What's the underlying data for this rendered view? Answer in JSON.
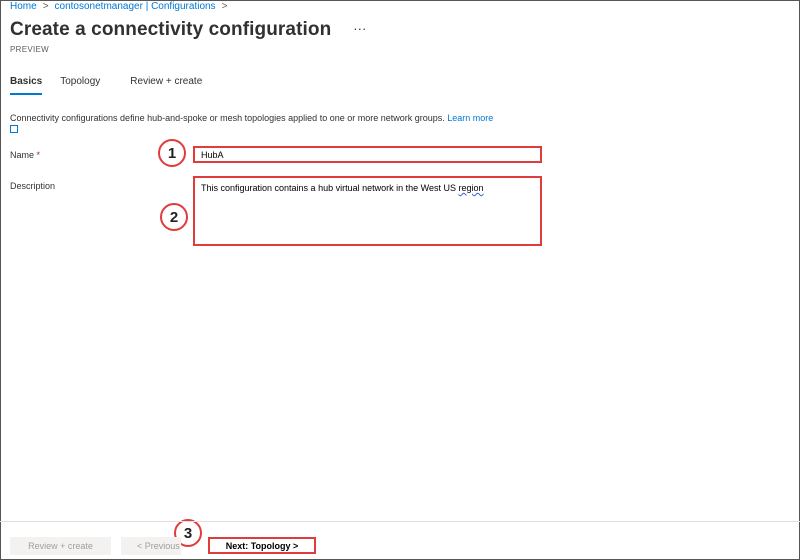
{
  "breadcrumb": {
    "items": [
      "Home",
      "contosonetmanager | Configurations"
    ],
    "separator": ">"
  },
  "header": {
    "title": "Create a connectivity configuration",
    "more": "···",
    "subtitle": "PREVIEW"
  },
  "tabs": [
    {
      "label": "Basics",
      "active": true
    },
    {
      "label": "Topology",
      "active": false
    },
    {
      "label": "Review + create",
      "active": false
    }
  ],
  "intro": {
    "text": "Connectivity configurations define hub-and-spoke or mesh topologies applied to one or more network groups.",
    "link": "Learn more"
  },
  "form": {
    "name_label": "Name",
    "required_mark": "*",
    "name_value": "HubA",
    "description_label": "Description",
    "description_text": "This configuration contains a hub virtual network in the West US ",
    "description_last_word": "region"
  },
  "callouts": [
    "1",
    "2",
    "3"
  ],
  "footer": {
    "review_label": "Review + create",
    "previous_label": "< Previous",
    "next_label": "Next: Topology >"
  },
  "colors": {
    "accent": "#0078d4",
    "highlight": "#e03c3c"
  }
}
